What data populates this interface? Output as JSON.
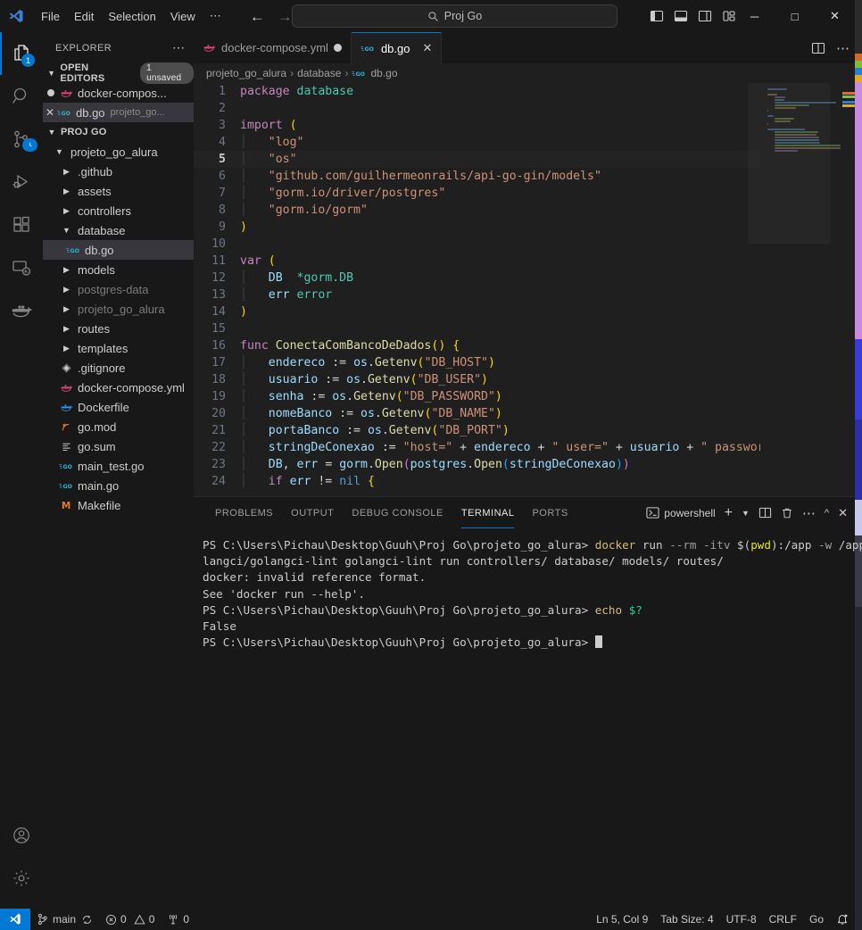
{
  "titlebar": {
    "logo_icon": "vscode-logo-icon",
    "menus": [
      "File",
      "Edit",
      "Selection",
      "View",
      "⋯"
    ],
    "nav": {
      "back_icon": "arrow-left-icon",
      "forward_icon": "arrow-right-icon"
    },
    "command_center": {
      "search_icon": "search-icon",
      "text": "Proj Go"
    },
    "layout_icons": [
      "toggle-primary-sidebar-icon",
      "toggle-panel-icon",
      "toggle-secondary-sidebar-icon",
      "customize-layout-icon"
    ],
    "window_controls": {
      "minimize": "─",
      "maximize": "□",
      "close": "✕"
    }
  },
  "activitybar": {
    "items": [
      {
        "name": "explorer",
        "icon": "files-icon",
        "active": true,
        "badge": "1"
      },
      {
        "name": "search",
        "icon": "search-icon",
        "active": false,
        "badge": ""
      },
      {
        "name": "source-control",
        "icon": "source-control-icon",
        "active": false,
        "badge": ""
      },
      {
        "name": "run-and-debug",
        "icon": "debug-icon",
        "active": false,
        "badge": ""
      },
      {
        "name": "extensions",
        "icon": "extensions-icon",
        "active": false,
        "badge": ""
      },
      {
        "name": "remote-explorer",
        "icon": "remote-explorer-icon",
        "active": false,
        "badge": ""
      },
      {
        "name": "docker",
        "icon": "docker-icon",
        "active": false,
        "badge": ""
      }
    ],
    "bottom_items": [
      {
        "name": "accounts",
        "icon": "account-icon"
      },
      {
        "name": "manage",
        "icon": "gear-icon"
      }
    ]
  },
  "sidebar": {
    "title": "EXPLORER",
    "more_icon": "more-actions-icon",
    "open_editors": {
      "label": "OPEN EDITORS",
      "badge": "1 unsaved",
      "items": [
        {
          "name": "docker-compose.yml",
          "display": "docker-compos...",
          "icon": "docker-icon",
          "dirty": true,
          "selected": false,
          "path": ""
        },
        {
          "name": "db.go",
          "display": "db.go",
          "icon": "go-icon",
          "dirty": false,
          "selected": true,
          "path": "projeto_go..."
        }
      ]
    },
    "workspace": {
      "label": "PROJ GO",
      "tree": [
        {
          "label": "projeto_go_alura",
          "type": "folder",
          "expanded": true,
          "depth": 1,
          "icon": "chevron-down-icon"
        },
        {
          "label": ".github",
          "type": "folder",
          "expanded": false,
          "depth": 2,
          "icon": "chevron-right-icon"
        },
        {
          "label": "assets",
          "type": "folder",
          "expanded": false,
          "depth": 2,
          "icon": "chevron-right-icon"
        },
        {
          "label": "controllers",
          "type": "folder",
          "expanded": false,
          "depth": 2,
          "icon": "chevron-right-icon"
        },
        {
          "label": "database",
          "type": "folder",
          "expanded": true,
          "depth": 2,
          "icon": "chevron-down-icon"
        },
        {
          "label": "db.go",
          "type": "file",
          "filetype": "go",
          "depth": 3,
          "selected": true,
          "icon": "go-icon"
        },
        {
          "label": "models",
          "type": "folder",
          "expanded": false,
          "depth": 2,
          "icon": "chevron-right-icon"
        },
        {
          "label": "postgres-data",
          "type": "folder",
          "expanded": false,
          "depth": 2,
          "dimmed": true,
          "icon": "chevron-right-icon"
        },
        {
          "label": "projeto_go_alura",
          "type": "folder",
          "expanded": false,
          "depth": 2,
          "dimmed": true,
          "icon": "chevron-right-icon"
        },
        {
          "label": "routes",
          "type": "folder",
          "expanded": false,
          "depth": 2,
          "icon": "chevron-right-icon"
        },
        {
          "label": "templates",
          "type": "folder",
          "expanded": false,
          "depth": 2,
          "icon": "chevron-right-icon"
        },
        {
          "label": ".gitignore",
          "type": "file",
          "filetype": "git",
          "depth": 2,
          "icon": "gitignore-icon"
        },
        {
          "label": "docker-compose.yml",
          "type": "file",
          "filetype": "docker-pink",
          "depth": 2,
          "icon": "docker-icon"
        },
        {
          "label": "Dockerfile",
          "type": "file",
          "filetype": "docker-blue",
          "depth": 2,
          "icon": "docker-icon"
        },
        {
          "label": "go.mod",
          "type": "file",
          "filetype": "mod",
          "depth": 2,
          "icon": "go-mod-icon"
        },
        {
          "label": "go.sum",
          "type": "file",
          "filetype": "sum",
          "depth": 2,
          "icon": "go-sum-icon"
        },
        {
          "label": "main_test.go",
          "type": "file",
          "filetype": "go",
          "depth": 2,
          "icon": "go-icon"
        },
        {
          "label": "main.go",
          "type": "file",
          "filetype": "go",
          "depth": 2,
          "icon": "go-icon"
        },
        {
          "label": "Makefile",
          "type": "file",
          "filetype": "make",
          "depth": 2,
          "icon": "makefile-icon"
        }
      ]
    }
  },
  "editor": {
    "tabs": [
      {
        "label": "docker-compose.yml",
        "icon": "docker-icon",
        "dirty": true,
        "active": false
      },
      {
        "label": "db.go",
        "icon": "go-icon",
        "dirty": false,
        "active": true,
        "close_icon": "close-icon"
      }
    ],
    "tab_actions": [
      "split-editor-icon",
      "more-actions-icon"
    ],
    "breadcrumb": [
      "projeto_go_alura",
      "database",
      "db.go"
    ],
    "breadcrumb_sep": "›",
    "language": "go",
    "current_line": 5,
    "lines": [
      {
        "n": 1,
        "tokens": [
          {
            "t": "package ",
            "c": "k"
          },
          {
            "t": "database",
            "c": "pk"
          }
        ]
      },
      {
        "n": 2,
        "tokens": []
      },
      {
        "n": 3,
        "tokens": [
          {
            "t": "import ",
            "c": "k"
          },
          {
            "t": "(",
            "c": "pr"
          }
        ]
      },
      {
        "n": 4,
        "tokens": [
          {
            "t": "    ",
            "c": "ind"
          },
          {
            "t": "\"log\"",
            "c": "st"
          }
        ]
      },
      {
        "n": 5,
        "tokens": [
          {
            "t": "    ",
            "c": "ind"
          },
          {
            "t": "\"os\"",
            "c": "st"
          }
        ]
      },
      {
        "n": 6,
        "tokens": [
          {
            "t": "    ",
            "c": "ind"
          },
          {
            "t": "\"github.com/guilhermeonrails/api-go-gin/models\"",
            "c": "st"
          }
        ]
      },
      {
        "n": 7,
        "tokens": [
          {
            "t": "    ",
            "c": "ind"
          },
          {
            "t": "\"gorm.io/driver/postgres\"",
            "c": "st"
          }
        ]
      },
      {
        "n": 8,
        "tokens": [
          {
            "t": "    ",
            "c": "ind"
          },
          {
            "t": "\"gorm.io/gorm\"",
            "c": "st"
          }
        ]
      },
      {
        "n": 9,
        "tokens": [
          {
            "t": ")",
            "c": "pr"
          }
        ]
      },
      {
        "n": 10,
        "tokens": []
      },
      {
        "n": 11,
        "tokens": [
          {
            "t": "var ",
            "c": "k"
          },
          {
            "t": "(",
            "c": "pr"
          }
        ]
      },
      {
        "n": 12,
        "tokens": [
          {
            "t": "    ",
            "c": "ind"
          },
          {
            "t": "DB",
            "c": "id"
          },
          {
            "t": "  ",
            "c": "op"
          },
          {
            "t": "*gorm.DB",
            "c": "ty"
          }
        ]
      },
      {
        "n": 13,
        "tokens": [
          {
            "t": "    ",
            "c": "ind"
          },
          {
            "t": "err ",
            "c": "id"
          },
          {
            "t": "error",
            "c": "ty"
          }
        ]
      },
      {
        "n": 14,
        "tokens": [
          {
            "t": ")",
            "c": "pr"
          }
        ]
      },
      {
        "n": 15,
        "tokens": []
      },
      {
        "n": 16,
        "tokens": [
          {
            "t": "func ",
            "c": "k"
          },
          {
            "t": "ConectaComBancoDeDados",
            "c": "fn"
          },
          {
            "t": "()",
            "c": "pr"
          },
          {
            "t": " ",
            "c": "op"
          },
          {
            "t": "{",
            "c": "pr"
          }
        ]
      },
      {
        "n": 17,
        "tokens": [
          {
            "t": "    ",
            "c": "ind"
          },
          {
            "t": "endereco ",
            "c": "id"
          },
          {
            "t": ":= ",
            "c": "op"
          },
          {
            "t": "os",
            "c": "id"
          },
          {
            "t": ".",
            "c": "op"
          },
          {
            "t": "Getenv",
            "c": "fn"
          },
          {
            "t": "(",
            "c": "pr"
          },
          {
            "t": "\"DB_HOST\"",
            "c": "st"
          },
          {
            "t": ")",
            "c": "pr"
          }
        ]
      },
      {
        "n": 18,
        "tokens": [
          {
            "t": "    ",
            "c": "ind"
          },
          {
            "t": "usuario ",
            "c": "id"
          },
          {
            "t": ":= ",
            "c": "op"
          },
          {
            "t": "os",
            "c": "id"
          },
          {
            "t": ".",
            "c": "op"
          },
          {
            "t": "Getenv",
            "c": "fn"
          },
          {
            "t": "(",
            "c": "pr"
          },
          {
            "t": "\"DB_USER\"",
            "c": "st"
          },
          {
            "t": ")",
            "c": "pr"
          }
        ]
      },
      {
        "n": 19,
        "tokens": [
          {
            "t": "    ",
            "c": "ind"
          },
          {
            "t": "senha ",
            "c": "id"
          },
          {
            "t": ":= ",
            "c": "op"
          },
          {
            "t": "os",
            "c": "id"
          },
          {
            "t": ".",
            "c": "op"
          },
          {
            "t": "Getenv",
            "c": "fn"
          },
          {
            "t": "(",
            "c": "pr"
          },
          {
            "t": "\"DB_PASSWORD\"",
            "c": "st"
          },
          {
            "t": ")",
            "c": "pr"
          }
        ]
      },
      {
        "n": 20,
        "tokens": [
          {
            "t": "    ",
            "c": "ind"
          },
          {
            "t": "nomeBanco ",
            "c": "id"
          },
          {
            "t": ":= ",
            "c": "op"
          },
          {
            "t": "os",
            "c": "id"
          },
          {
            "t": ".",
            "c": "op"
          },
          {
            "t": "Getenv",
            "c": "fn"
          },
          {
            "t": "(",
            "c": "pr"
          },
          {
            "t": "\"DB_NAME\"",
            "c": "st"
          },
          {
            "t": ")",
            "c": "pr"
          }
        ]
      },
      {
        "n": 21,
        "tokens": [
          {
            "t": "    ",
            "c": "ind"
          },
          {
            "t": "portaBanco ",
            "c": "id"
          },
          {
            "t": ":= ",
            "c": "op"
          },
          {
            "t": "os",
            "c": "id"
          },
          {
            "t": ".",
            "c": "op"
          },
          {
            "t": "Getenv",
            "c": "fn"
          },
          {
            "t": "(",
            "c": "pr"
          },
          {
            "t": "\"DB_PORT\"",
            "c": "st"
          },
          {
            "t": ")",
            "c": "pr"
          }
        ]
      },
      {
        "n": 22,
        "tokens": [
          {
            "t": "    ",
            "c": "ind"
          },
          {
            "t": "stringDeConexao ",
            "c": "id"
          },
          {
            "t": ":= ",
            "c": "op"
          },
          {
            "t": "\"host=\"",
            "c": "st"
          },
          {
            "t": " + ",
            "c": "op"
          },
          {
            "t": "endereco",
            "c": "id"
          },
          {
            "t": " + ",
            "c": "op"
          },
          {
            "t": "\" user=\"",
            "c": "st"
          },
          {
            "t": " + ",
            "c": "op"
          },
          {
            "t": "usuario",
            "c": "id"
          },
          {
            "t": " + ",
            "c": "op"
          },
          {
            "t": "\" password",
            "c": "st"
          }
        ]
      },
      {
        "n": 23,
        "tokens": [
          {
            "t": "    ",
            "c": "ind"
          },
          {
            "t": "DB",
            "c": "id"
          },
          {
            "t": ", ",
            "c": "op"
          },
          {
            "t": "err ",
            "c": "id"
          },
          {
            "t": "= ",
            "c": "op"
          },
          {
            "t": "gorm",
            "c": "id"
          },
          {
            "t": ".",
            "c": "op"
          },
          {
            "t": "Open",
            "c": "fn"
          },
          {
            "t": "(",
            "c": "pr2"
          },
          {
            "t": "postgres",
            "c": "id"
          },
          {
            "t": ".",
            "c": "op"
          },
          {
            "t": "Open",
            "c": "fn"
          },
          {
            "t": "(",
            "c": "pr3"
          },
          {
            "t": "stringDeConexao",
            "c": "id"
          },
          {
            "t": ")",
            "c": "pr3"
          },
          {
            "t": ")",
            "c": "pr2"
          }
        ]
      },
      {
        "n": 24,
        "tokens": [
          {
            "t": "    ",
            "c": "ind"
          },
          {
            "t": "if ",
            "c": "k"
          },
          {
            "t": "err ",
            "c": "id"
          },
          {
            "t": "!= ",
            "c": "op"
          },
          {
            "t": "nil",
            "c": "nb"
          },
          {
            "t": " ",
            "c": "op"
          },
          {
            "t": "{",
            "c": "pr"
          }
        ]
      }
    ]
  },
  "panel": {
    "tabs": [
      "PROBLEMS",
      "OUTPUT",
      "DEBUG CONSOLE",
      "TERMINAL",
      "PORTS"
    ],
    "active_tab": "TERMINAL",
    "shell": {
      "icon": "powershell-icon",
      "label": "powershell"
    },
    "actions": [
      "new-terminal-icon",
      "chevron-down-icon",
      "split-terminal-icon",
      "trash-icon",
      "more-actions-icon",
      "chevron-up-icon",
      "close-icon"
    ],
    "terminal_lines": [
      {
        "segments": [
          {
            "t": "PS C:\\Users\\Pichau\\Desktop\\Guuh\\Proj Go\\projeto_go_alura> ",
            "c": ""
          },
          {
            "t": "docker",
            "c": "t-cmd"
          },
          {
            "t": " run ",
            "c": ""
          },
          {
            "t": "--rm -itv ",
            "c": "t-flag"
          },
          {
            "t": "$(",
            "c": ""
          },
          {
            "t": "pwd",
            "c": "t-yel"
          },
          {
            "t": "):/app ",
            "c": ""
          },
          {
            "t": "-w",
            "c": "t-flag"
          },
          {
            "t": " /app go",
            "c": ""
          }
        ]
      },
      {
        "segments": [
          {
            "t": "langci/golangci-lint golangci-lint run controllers/ database/ models/ routes/",
            "c": ""
          }
        ]
      },
      {
        "segments": [
          {
            "t": "docker: invalid reference format.",
            "c": ""
          }
        ]
      },
      {
        "segments": [
          {
            "t": "See 'docker run --help'.",
            "c": ""
          }
        ]
      },
      {
        "segments": [
          {
            "t": "PS C:\\Users\\Pichau\\Desktop\\Guuh\\Proj Go\\projeto_go_alura> ",
            "c": ""
          },
          {
            "t": "echo",
            "c": "t-cmd"
          },
          {
            "t": " ",
            "c": ""
          },
          {
            "t": "$?",
            "c": "t-grn"
          }
        ]
      },
      {
        "segments": [
          {
            "t": "False",
            "c": ""
          }
        ]
      },
      {
        "segments": [
          {
            "t": "PS C:\\Users\\Pichau\\Desktop\\Guuh\\Proj Go\\projeto_go_alura> ",
            "c": ""
          },
          {
            "t": "",
            "c": "cursor"
          }
        ]
      }
    ]
  },
  "statusbar": {
    "remote_icon": "remote-window-icon",
    "left": [
      {
        "name": "branch",
        "icon": "source-control-icon",
        "label": "main",
        "extra_icon": "sync-icon"
      },
      {
        "name": "problems",
        "icon": "error-icon",
        "label": "0",
        "icon2": "warning-icon",
        "label2": "0"
      },
      {
        "name": "ports",
        "icon": "radio-tower-icon",
        "label": "0"
      }
    ],
    "right": [
      {
        "name": "cursor-position",
        "label": "Ln 5, Col 9"
      },
      {
        "name": "tab-size",
        "label": "Tab Size: 4"
      },
      {
        "name": "encoding",
        "label": "UTF-8"
      },
      {
        "name": "eol",
        "label": "CRLF"
      },
      {
        "name": "language-mode",
        "label": "Go"
      },
      {
        "name": "notifications",
        "icon": "bell-dot-icon",
        "label": ""
      }
    ]
  }
}
